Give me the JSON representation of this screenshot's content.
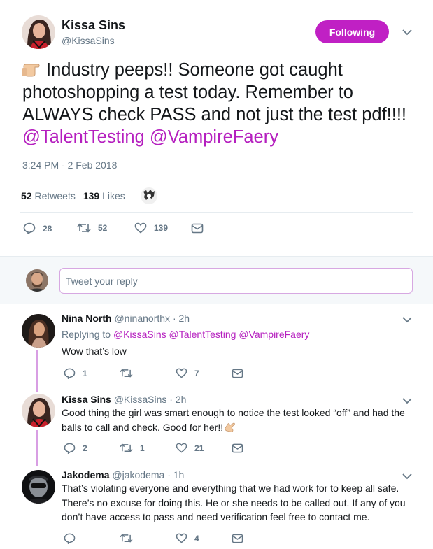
{
  "main_tweet": {
    "author": {
      "name": "Kissa Sins",
      "handle": "@KissaSins"
    },
    "follow_label": "Following",
    "text": "Industry peeps!! Someone got caught photoshopping a test today. Remember to ALWAYS check PASS and not just the test pdf!!!! ",
    "mentions": [
      "@TalentTesting",
      "@VampireFaery"
    ],
    "timestamp": "3:24 PM - 2 Feb 2018",
    "retweets_count": "52",
    "retweets_label": "Retweets",
    "likes_count": "139",
    "likes_label": "Likes",
    "actions": {
      "replies": "28",
      "retweets": "52",
      "likes": "139"
    }
  },
  "reply_box": {
    "placeholder": "Tweet your reply"
  },
  "replies": [
    {
      "name": "Nina North",
      "handle": "@ninanorthx",
      "time": "· 2h",
      "replying_prefix": "Replying to",
      "replying_to": "@KissaSins @TalentTesting @VampireFaery",
      "text": "Wow that’s low",
      "actions": {
        "replies": "1",
        "retweets": "",
        "likes": "7"
      }
    },
    {
      "name": "Kissa Sins",
      "handle": "@KissaSins",
      "time": "· 2h",
      "text": "Good thing the girl was smart enough to notice the test looked “off” and had the balls to call and check. Good for her!!",
      "actions": {
        "replies": "2",
        "retweets": "1",
        "likes": "21"
      }
    },
    {
      "name": "Jakodema",
      "handle": "@jakodema",
      "time": "· 1h",
      "text": "That’s violating everyone and everything that we had work for to keep all safe. There’s no excuse for doing this. He or she needs to be called out. If any of you don’t have access to pass and need verification feel free to contact me.",
      "actions": {
        "replies": "",
        "retweets": "",
        "likes": "4"
      }
    }
  ],
  "colors": {
    "accent": "#c020c4",
    "mention": "#b51fbf",
    "thread_line": "#d89ee3",
    "muted": "#657786"
  }
}
